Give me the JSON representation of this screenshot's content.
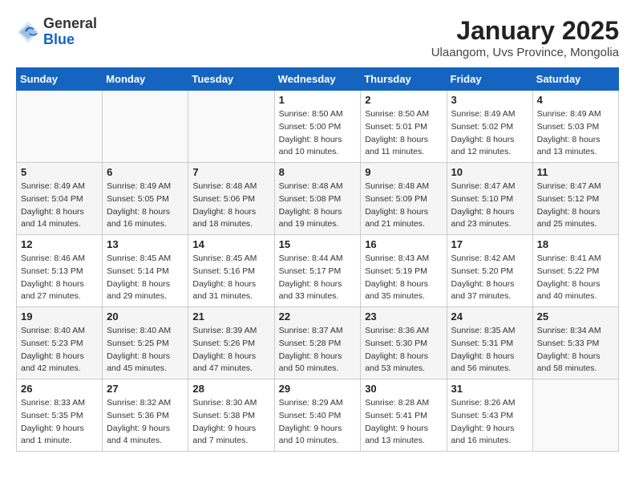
{
  "header": {
    "logo_general": "General",
    "logo_blue": "Blue",
    "month_title": "January 2025",
    "subtitle": "Ulaangom, Uvs Province, Mongolia"
  },
  "days_of_week": [
    "Sunday",
    "Monday",
    "Tuesday",
    "Wednesday",
    "Thursday",
    "Friday",
    "Saturday"
  ],
  "weeks": [
    [
      {
        "day": "",
        "info": ""
      },
      {
        "day": "",
        "info": ""
      },
      {
        "day": "",
        "info": ""
      },
      {
        "day": "1",
        "info": "Sunrise: 8:50 AM\nSunset: 5:00 PM\nDaylight: 8 hours\nand 10 minutes."
      },
      {
        "day": "2",
        "info": "Sunrise: 8:50 AM\nSunset: 5:01 PM\nDaylight: 8 hours\nand 11 minutes."
      },
      {
        "day": "3",
        "info": "Sunrise: 8:49 AM\nSunset: 5:02 PM\nDaylight: 8 hours\nand 12 minutes."
      },
      {
        "day": "4",
        "info": "Sunrise: 8:49 AM\nSunset: 5:03 PM\nDaylight: 8 hours\nand 13 minutes."
      }
    ],
    [
      {
        "day": "5",
        "info": "Sunrise: 8:49 AM\nSunset: 5:04 PM\nDaylight: 8 hours\nand 14 minutes."
      },
      {
        "day": "6",
        "info": "Sunrise: 8:49 AM\nSunset: 5:05 PM\nDaylight: 8 hours\nand 16 minutes."
      },
      {
        "day": "7",
        "info": "Sunrise: 8:48 AM\nSunset: 5:06 PM\nDaylight: 8 hours\nand 18 minutes."
      },
      {
        "day": "8",
        "info": "Sunrise: 8:48 AM\nSunset: 5:08 PM\nDaylight: 8 hours\nand 19 minutes."
      },
      {
        "day": "9",
        "info": "Sunrise: 8:48 AM\nSunset: 5:09 PM\nDaylight: 8 hours\nand 21 minutes."
      },
      {
        "day": "10",
        "info": "Sunrise: 8:47 AM\nSunset: 5:10 PM\nDaylight: 8 hours\nand 23 minutes."
      },
      {
        "day": "11",
        "info": "Sunrise: 8:47 AM\nSunset: 5:12 PM\nDaylight: 8 hours\nand 25 minutes."
      }
    ],
    [
      {
        "day": "12",
        "info": "Sunrise: 8:46 AM\nSunset: 5:13 PM\nDaylight: 8 hours\nand 27 minutes."
      },
      {
        "day": "13",
        "info": "Sunrise: 8:45 AM\nSunset: 5:14 PM\nDaylight: 8 hours\nand 29 minutes."
      },
      {
        "day": "14",
        "info": "Sunrise: 8:45 AM\nSunset: 5:16 PM\nDaylight: 8 hours\nand 31 minutes."
      },
      {
        "day": "15",
        "info": "Sunrise: 8:44 AM\nSunset: 5:17 PM\nDaylight: 8 hours\nand 33 minutes."
      },
      {
        "day": "16",
        "info": "Sunrise: 8:43 AM\nSunset: 5:19 PM\nDaylight: 8 hours\nand 35 minutes."
      },
      {
        "day": "17",
        "info": "Sunrise: 8:42 AM\nSunset: 5:20 PM\nDaylight: 8 hours\nand 37 minutes."
      },
      {
        "day": "18",
        "info": "Sunrise: 8:41 AM\nSunset: 5:22 PM\nDaylight: 8 hours\nand 40 minutes."
      }
    ],
    [
      {
        "day": "19",
        "info": "Sunrise: 8:40 AM\nSunset: 5:23 PM\nDaylight: 8 hours\nand 42 minutes."
      },
      {
        "day": "20",
        "info": "Sunrise: 8:40 AM\nSunset: 5:25 PM\nDaylight: 8 hours\nand 45 minutes."
      },
      {
        "day": "21",
        "info": "Sunrise: 8:39 AM\nSunset: 5:26 PM\nDaylight: 8 hours\nand 47 minutes."
      },
      {
        "day": "22",
        "info": "Sunrise: 8:37 AM\nSunset: 5:28 PM\nDaylight: 8 hours\nand 50 minutes."
      },
      {
        "day": "23",
        "info": "Sunrise: 8:36 AM\nSunset: 5:30 PM\nDaylight: 8 hours\nand 53 minutes."
      },
      {
        "day": "24",
        "info": "Sunrise: 8:35 AM\nSunset: 5:31 PM\nDaylight: 8 hours\nand 56 minutes."
      },
      {
        "day": "25",
        "info": "Sunrise: 8:34 AM\nSunset: 5:33 PM\nDaylight: 8 hours\nand 58 minutes."
      }
    ],
    [
      {
        "day": "26",
        "info": "Sunrise: 8:33 AM\nSunset: 5:35 PM\nDaylight: 9 hours\nand 1 minute."
      },
      {
        "day": "27",
        "info": "Sunrise: 8:32 AM\nSunset: 5:36 PM\nDaylight: 9 hours\nand 4 minutes."
      },
      {
        "day": "28",
        "info": "Sunrise: 8:30 AM\nSunset: 5:38 PM\nDaylight: 9 hours\nand 7 minutes."
      },
      {
        "day": "29",
        "info": "Sunrise: 8:29 AM\nSunset: 5:40 PM\nDaylight: 9 hours\nand 10 minutes."
      },
      {
        "day": "30",
        "info": "Sunrise: 8:28 AM\nSunset: 5:41 PM\nDaylight: 9 hours\nand 13 minutes."
      },
      {
        "day": "31",
        "info": "Sunrise: 8:26 AM\nSunset: 5:43 PM\nDaylight: 9 hours\nand 16 minutes."
      },
      {
        "day": "",
        "info": ""
      }
    ]
  ]
}
